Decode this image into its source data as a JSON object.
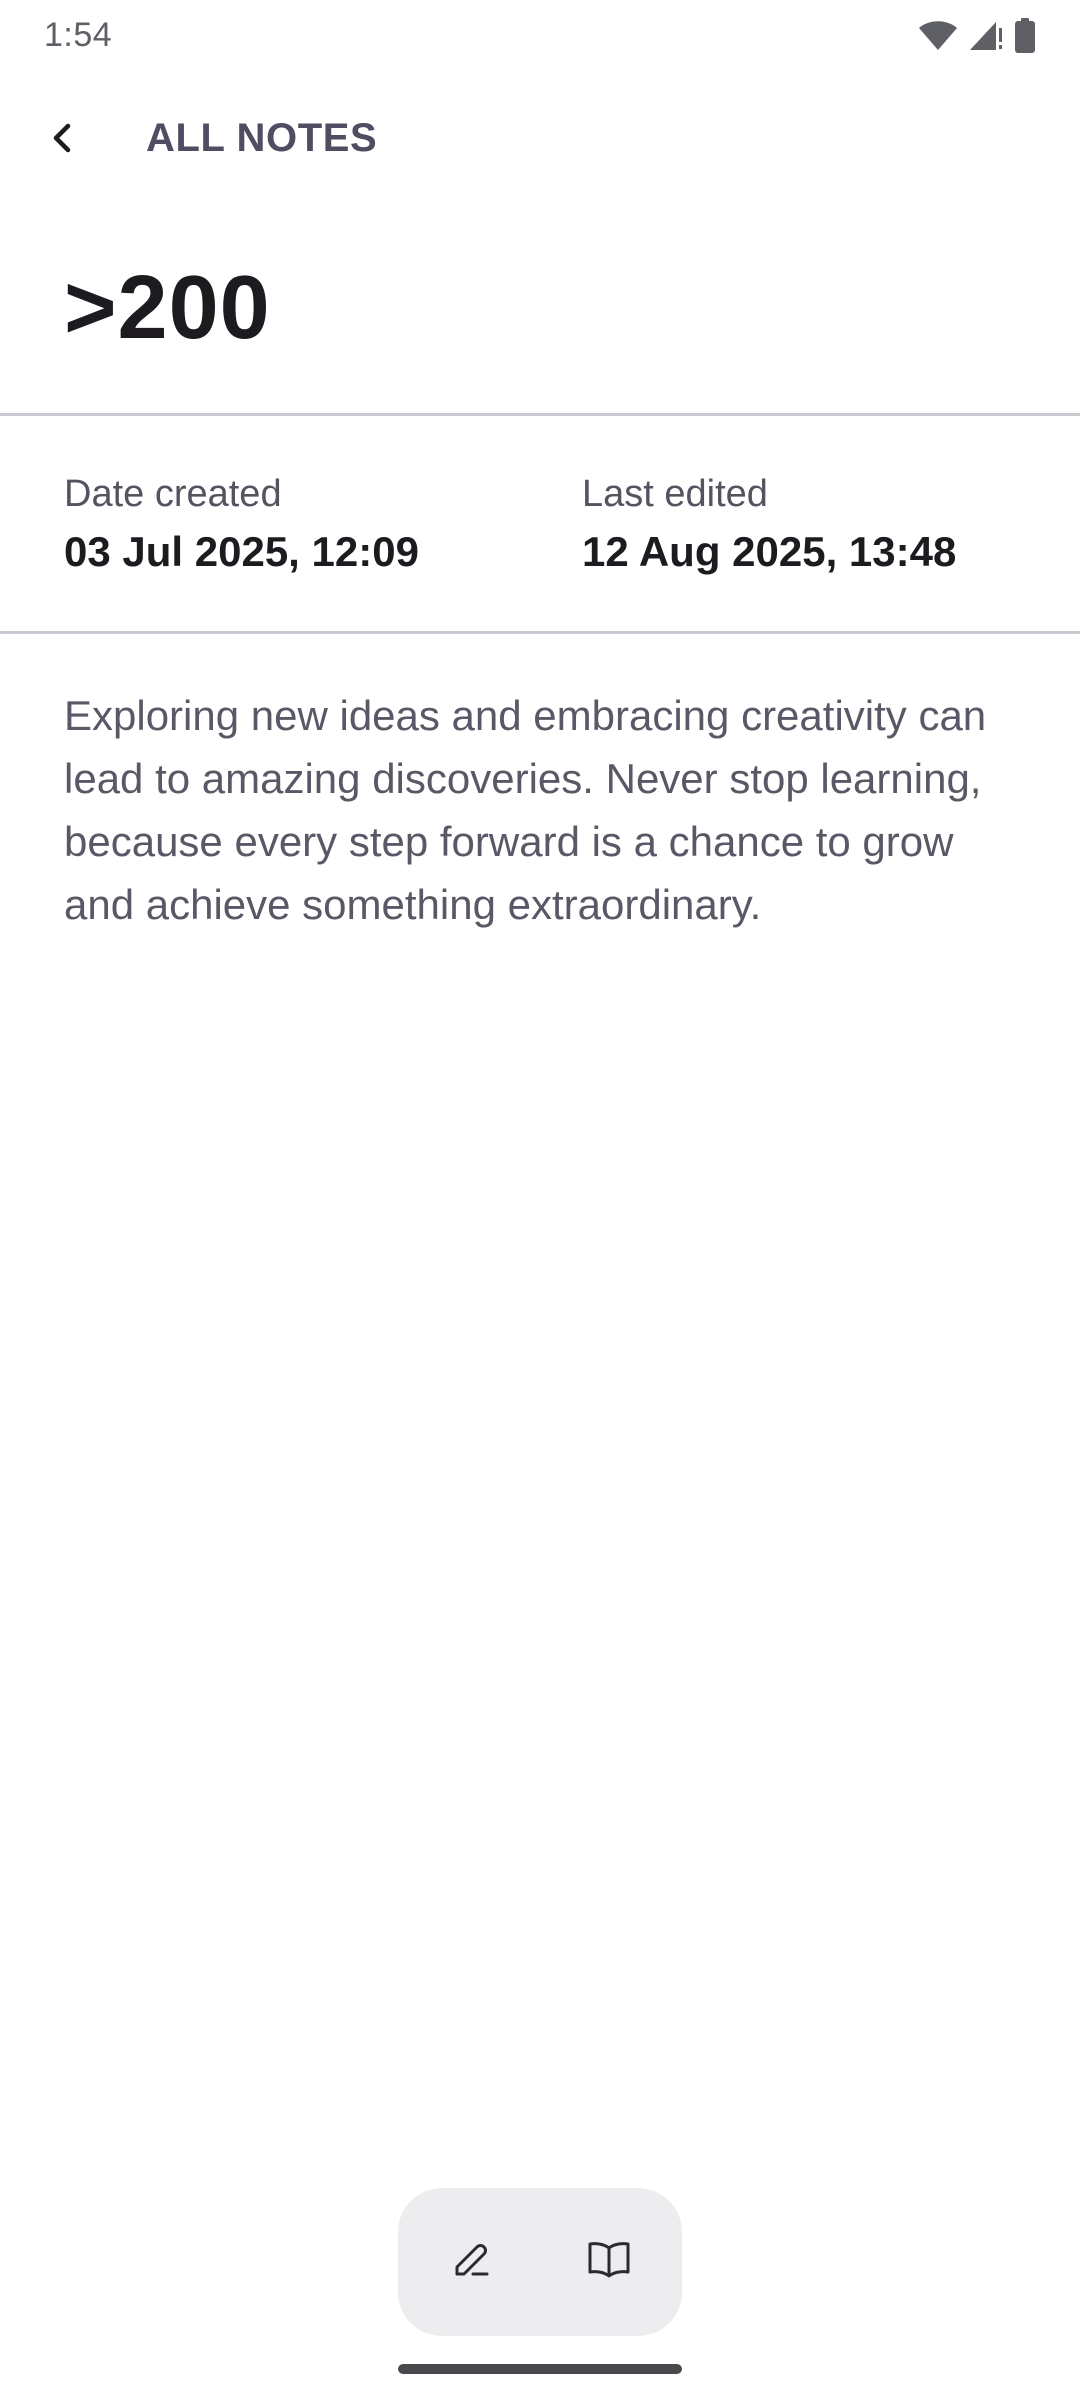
{
  "status_bar": {
    "time": "1:54",
    "icons": [
      "wifi-icon",
      "cell-signal-icon",
      "battery-icon"
    ]
  },
  "top_bar": {
    "back_icon": "chevron-left-icon",
    "title": "ALL NOTES"
  },
  "note": {
    "title": ">200",
    "date_created_label": "Date created",
    "date_created_value": "03 Jul 2025, 12:09",
    "last_edited_label": "Last edited",
    "last_edited_value": "12 Aug 2025, 13:48",
    "body": "Exploring new ideas and embracing creativity can lead to amazing discoveries. Never stop learning, because every step forward is a chance to grow and achieve something extraordinary."
  },
  "toolbar": {
    "edit_icon": "pencil-icon",
    "read_icon": "book-icon"
  },
  "colors": {
    "divider": "#c9c8d3",
    "toolbar_bg": "#ededf0",
    "title_text": "#1d1b20",
    "body_text": "#5a5866",
    "top_bar_text": "#4f4d62"
  }
}
